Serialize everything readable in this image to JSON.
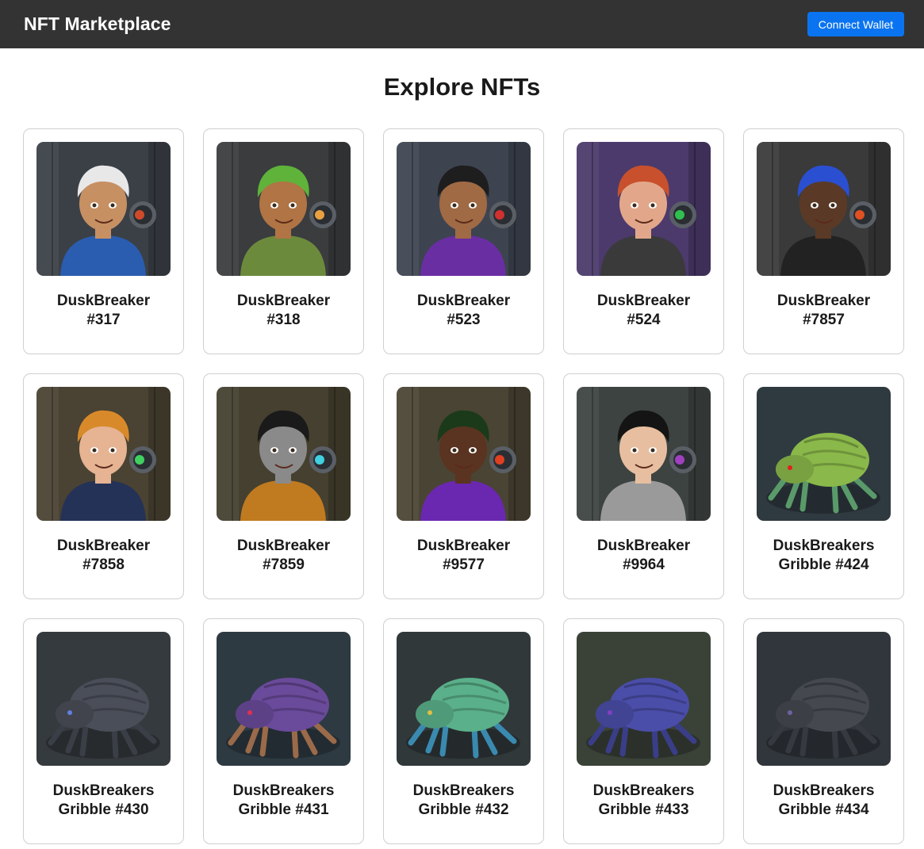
{
  "header": {
    "brand": "NFT Marketplace",
    "connect_label": "Connect Wallet"
  },
  "main": {
    "heading": "Explore NFTs"
  },
  "nfts": [
    {
      "line1": "DuskBreaker",
      "line2": "#317",
      "art": "character",
      "bg": "#3b4047",
      "hair": "#e8e8e8",
      "skin": "#c79063",
      "outfit": "#2a5db0",
      "accent": "#d04a2a"
    },
    {
      "line1": "DuskBreaker",
      "line2": "#318",
      "art": "character",
      "bg": "#3a3c3e",
      "hair": "#5fb33a",
      "skin": "#b07445",
      "outfit": "#6c8a3c",
      "accent": "#e8a040"
    },
    {
      "line1": "DuskBreaker",
      "line2": "#523",
      "art": "character",
      "bg": "#3d4450",
      "hair": "#1e1e1e",
      "skin": "#a06a44",
      "outfit": "#6a2ea3",
      "accent": "#d03030"
    },
    {
      "line1": "DuskBreaker",
      "line2": "#524",
      "art": "character",
      "bg": "#4b3a6b",
      "hair": "#c8502c",
      "skin": "#e2a78a",
      "outfit": "#3a3a3a",
      "accent": "#30c050"
    },
    {
      "line1": "DuskBreaker",
      "line2": "#7857",
      "art": "character",
      "bg": "#3a3a3a",
      "hair": "#2a4fd0",
      "skin": "#5a3a26",
      "outfit": "#222222",
      "accent": "#e05020"
    },
    {
      "line1": "DuskBreaker",
      "line2": "#7858",
      "art": "character",
      "bg": "#4a4232",
      "hair": "#d88a2a",
      "skin": "#e6b393",
      "outfit": "#243258",
      "accent": "#40d060"
    },
    {
      "line1": "DuskBreaker",
      "line2": "#7859",
      "art": "character",
      "bg": "#45402f",
      "hair": "#1a1a1a",
      "skin": "#8a8a8a",
      "outfit": "#c07a20",
      "accent": "#40d0e0"
    },
    {
      "line1": "DuskBreaker",
      "line2": "#9577",
      "art": "character",
      "bg": "#4a4434",
      "hair": "#1b3a1a",
      "skin": "#5a3420",
      "outfit": "#6a28b0",
      "accent": "#e04020"
    },
    {
      "line1": "DuskBreaker",
      "line2": "#9964",
      "art": "character",
      "bg": "#3d4340",
      "hair": "#141414",
      "skin": "#e7bfa0",
      "outfit": "#9a9a9a",
      "accent": "#a040c0"
    },
    {
      "line1": "DuskBreakers",
      "line2": "Gribble #424",
      "art": "gribble",
      "bg": "#2f3a40",
      "body": "#8ab84a",
      "leg": "#5a9a6a",
      "eye": "#e02020"
    },
    {
      "line1": "DuskBreakers",
      "line2": "Gribble #430",
      "art": "gribble",
      "bg": "#343a3e",
      "body": "#4a4e58",
      "leg": "#3a3e46",
      "eye": "#6080e0"
    },
    {
      "line1": "DuskBreakers",
      "line2": "Gribble #431",
      "art": "gribble",
      "bg": "#2e3a42",
      "body": "#6a4a9a",
      "leg": "#9a6a4a",
      "eye": "#e03050"
    },
    {
      "line1": "DuskBreakers",
      "line2": "Gribble #432",
      "art": "gribble",
      "bg": "#30383a",
      "body": "#5ab08a",
      "leg": "#3a8ab0",
      "eye": "#e0c040"
    },
    {
      "line1": "DuskBreakers",
      "line2": "Gribble #433",
      "art": "gribble",
      "bg": "#3a4238",
      "body": "#4a4ea8",
      "leg": "#3a3e88",
      "eye": "#8040c0"
    },
    {
      "line1": "DuskBreakers",
      "line2": "Gribble #434",
      "art": "gribble",
      "bg": "#30363c",
      "body": "#45484f",
      "leg": "#36393f",
      "eye": "#7060a0"
    }
  ]
}
